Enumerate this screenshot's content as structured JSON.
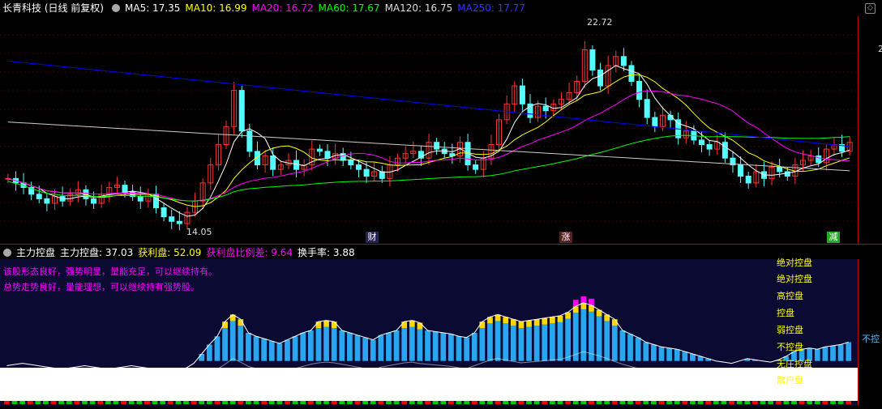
{
  "top_header": {
    "title": "长青科技 (日线 前复权)",
    "ma5": "MA5: 17.35",
    "ma10": "MA10: 16.99",
    "ma20": "MA20: 16.72",
    "ma60": "MA60: 17.67",
    "ma120": "MA120: 16.75",
    "ma250": "MA250: 17.77"
  },
  "annotations": {
    "high": "22.72",
    "low": "14.05",
    "tag_cai": "财",
    "tag_zhang": "涨",
    "tag_jian": "减",
    "right_axis": "2"
  },
  "bottom_header": {
    "indicator": "主力控盘",
    "zlkp": "主力控盘: 37.03",
    "hlp": "获利盘: 52.09",
    "hlpbl": "获利盘比例差: 9.64",
    "hsl": "换手率: 3.88"
  },
  "comments": {
    "line1": "该股形态良好，强势明显，量能充足，可以继续持有。",
    "line2": "总势走势良好，量能理想，可以继续持有强势股。"
  },
  "levels": [
    "绝对控盘",
    "绝对控盘",
    "高控盘",
    "控盘",
    "弱控盘",
    "不控盘",
    "无庄控盘",
    "散户盘"
  ],
  "right_label": "不控",
  "colors": {
    "ma5": "#ffffff",
    "ma10": "#ffff00",
    "ma20": "#ff00ff",
    "ma60": "#00ff00",
    "ma120": "#ffffff",
    "ma250": "#0000ff",
    "up": "#ff3232",
    "down": "#54ffff"
  },
  "chart_data": {
    "type": "candlestick",
    "price_high": 22.72,
    "price_low": 14.05,
    "ma_values": {
      "MA5": 17.35,
      "MA10": 16.99,
      "MA20": 16.72,
      "MA60": 17.67,
      "MA120": 16.75,
      "MA250": 17.77
    },
    "close": [
      16.3,
      16.1,
      15.9,
      15.6,
      15.4,
      15.2,
      15.5,
      15.3,
      15.6,
      15.8,
      15.4,
      15.2,
      15.6,
      15.9,
      16.0,
      15.7,
      15.5,
      15.3,
      15.6,
      15.0,
      14.6,
      14.4,
      14.3,
      14.8,
      15.3,
      16.1,
      16.9,
      17.8,
      18.6,
      20.2,
      18.4,
      17.5,
      16.9,
      17.3,
      16.7,
      16.9,
      17.1,
      16.7,
      16.9,
      17.6,
      17.5,
      17.2,
      17.4,
      17.1,
      16.9,
      16.7,
      16.4,
      16.6,
      16.3,
      16.9,
      17.2,
      17.4,
      17.5,
      17.2,
      17.9,
      17.6,
      17.4,
      17.3,
      17.9,
      16.9,
      16.7,
      17.2,
      17.8,
      18.9,
      19.6,
      20.4,
      19.6,
      19.0,
      19.5,
      19.3,
      19.6,
      19.8,
      20.1,
      20.6,
      22.0,
      21.1,
      20.4,
      21.3,
      21.7,
      21.3,
      20.6,
      19.8,
      19.0,
      18.6,
      19.1,
      18.9,
      18.1,
      18.4,
      18.0,
      17.8,
      17.6,
      17.9,
      17.2,
      16.9,
      16.4,
      16.1,
      16.6,
      16.3,
      16.8,
      16.6,
      16.4,
      16.9,
      17.1,
      17.3,
      17.0,
      17.6,
      17.8,
      17.5,
      17.9
    ],
    "zlkp": [
      30,
      31,
      32,
      31,
      30,
      29,
      28,
      27,
      28,
      29,
      30,
      29,
      28,
      27,
      28,
      29,
      30,
      29,
      28,
      27,
      26,
      25,
      26,
      28,
      32,
      40,
      48,
      55,
      62,
      68,
      64,
      58,
      55,
      53,
      51,
      49,
      52,
      55,
      58,
      60,
      62,
      63,
      62,
      60,
      58,
      56,
      54,
      52,
      56,
      58,
      60,
      62,
      63,
      61,
      60,
      59,
      58,
      57,
      55,
      54,
      58,
      62,
      66,
      68,
      66,
      64,
      62,
      63,
      64,
      65,
      66,
      67,
      70,
      75,
      78,
      76,
      72,
      68,
      64,
      60,
      57,
      54,
      50,
      48,
      46,
      45,
      44,
      42,
      40,
      38,
      36,
      34,
      33,
      32,
      34,
      36,
      35,
      34,
      33,
      35,
      38,
      42,
      44,
      45,
      44,
      46,
      47,
      48,
      50
    ],
    "hlp": [
      10,
      11,
      12,
      11,
      10,
      9,
      8,
      9,
      10,
      11,
      12,
      13,
      12,
      11,
      10,
      11,
      12,
      11,
      10,
      9,
      8,
      7,
      8,
      12,
      20,
      30,
      38,
      45,
      52,
      60,
      55,
      49,
      46,
      44,
      42,
      40,
      43,
      46,
      49,
      52,
      54,
      55,
      54,
      52,
      50,
      48,
      46,
      44,
      48,
      50,
      52,
      54,
      55,
      53,
      52,
      51,
      50,
      49,
      47,
      46,
      50,
      54,
      58,
      60,
      58,
      56,
      54,
      55,
      56,
      57,
      58,
      59,
      62,
      66,
      70,
      67,
      64,
      60,
      56,
      52,
      49,
      46,
      42,
      40,
      38,
      37,
      36,
      34,
      32,
      30,
      28,
      26,
      25,
      24,
      26,
      28,
      27,
      26,
      25,
      27,
      30,
      34,
      36,
      37,
      36,
      38,
      39,
      40,
      42
    ]
  }
}
